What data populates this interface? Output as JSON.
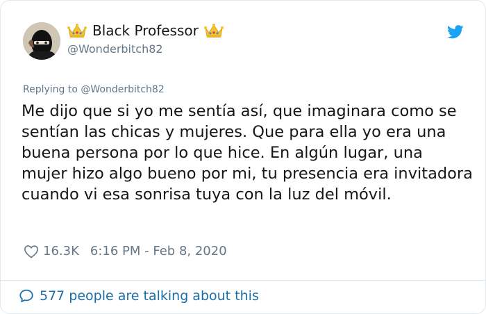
{
  "tweet": {
    "author": {
      "display_name": "Black Professor",
      "handle": "@Wonderbitch82",
      "name_emoji_icon": "crown-emoji-icon"
    },
    "platform_icon": "twitter-bird-icon",
    "replying_to": "Replying to @Wonderbitch82",
    "text": "Me dijo que si yo me sentía así, que imaginara como se sentían las chicas y mujeres. Que para ella yo era una buena persona por lo que hice. En algún lugar, una mujer hizo algo bueno por mi, tu presencia era invitadora cuando vi esa sonrisa tuya con la luz del móvil.",
    "likes": "16.3K",
    "timestamp": "6:16 PM - Feb 8, 2020",
    "conversation_link": "577 people are talking about this"
  },
  "colors": {
    "text": "#14171a",
    "secondary": "#657786",
    "twitter_blue": "#1da1f2",
    "link": "#1b6fa8",
    "border": "#e1e8ed",
    "crown_gold": "#f4c430"
  }
}
